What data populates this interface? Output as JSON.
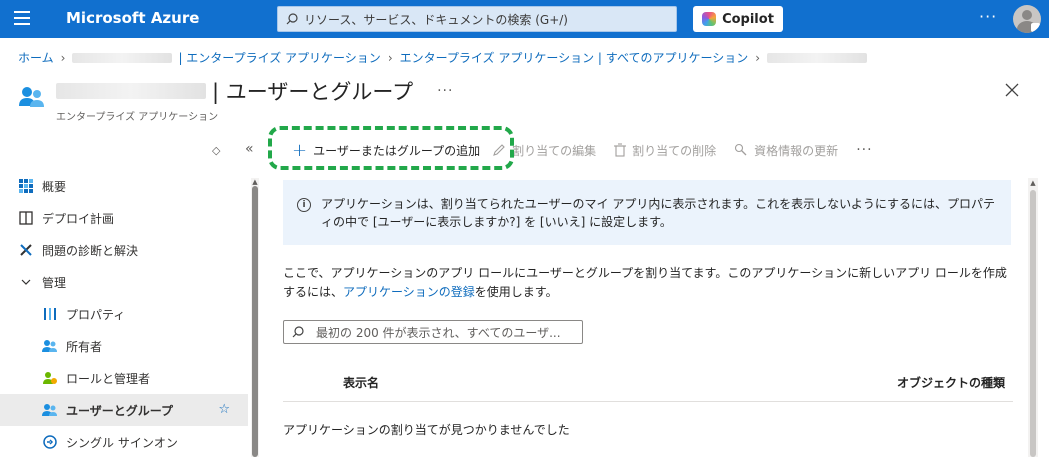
{
  "topbar": {
    "brand": "Microsoft Azure",
    "search_placeholder": "リソース、サービス、ドキュメントの検索 (G+/)",
    "copilot_label": "Copilot",
    "more": "···"
  },
  "breadcrumb": {
    "home": "ホーム",
    "item1_suffix": "| エンタープライズ アプリケーション",
    "item2": "エンタープライズ アプリケーション | すべてのアプリケーション"
  },
  "header": {
    "title": "| ユーザーとグループ",
    "subtitle": "エンタープライズ アプリケーション",
    "more": "···"
  },
  "sidebar": {
    "items": [
      {
        "label": "概要",
        "icon": "overview-grid-icon"
      },
      {
        "label": "デプロイ計画",
        "icon": "book-icon"
      },
      {
        "label": "問題の診断と解決",
        "icon": "wrench-icon"
      },
      {
        "label": "管理",
        "icon": "chevron-down-icon"
      },
      {
        "label": "プロパティ",
        "icon": "properties-icon"
      },
      {
        "label": "所有者",
        "icon": "owners-icon"
      },
      {
        "label": "ロールと管理者",
        "icon": "roles-icon"
      },
      {
        "label": "ユーザーとグループ",
        "icon": "users-groups-icon"
      },
      {
        "label": "シングル サインオン",
        "icon": "sso-icon"
      }
    ]
  },
  "toolbar": {
    "add": "ユーザーまたはグループの追加",
    "edit": "割り当ての編集",
    "remove": "割り当ての削除",
    "update": "資格情報の更新",
    "more": "···"
  },
  "info": {
    "text": "アプリケーションは、割り当てられたユーザーのマイ アプリ内に表示されます。これを表示しないようにするには、プロパティの中で [ユーザーに表示しますか?] を [いいえ] に設定します。"
  },
  "description": {
    "before_link": "ここで、アプリケーションのアプリ ロールにユーザーとグループを割り当てます。このアプリケーションに新しいアプリ ロールを作成するには、",
    "link": "アプリケーションの登録",
    "after_link": "を使用します。"
  },
  "filter": {
    "placeholder": "最初の 200 件が表示され、すべてのユーザ..."
  },
  "table": {
    "col_name": "表示名",
    "col_type": "オブジェクトの種類",
    "empty": "アプリケーションの割り当てが見つかりませんでした"
  },
  "colors": {
    "topbar": "#1170cf",
    "accent": "#0f6cbd",
    "highlight": "#22a84a",
    "info_bg": "#ebf3fc"
  }
}
